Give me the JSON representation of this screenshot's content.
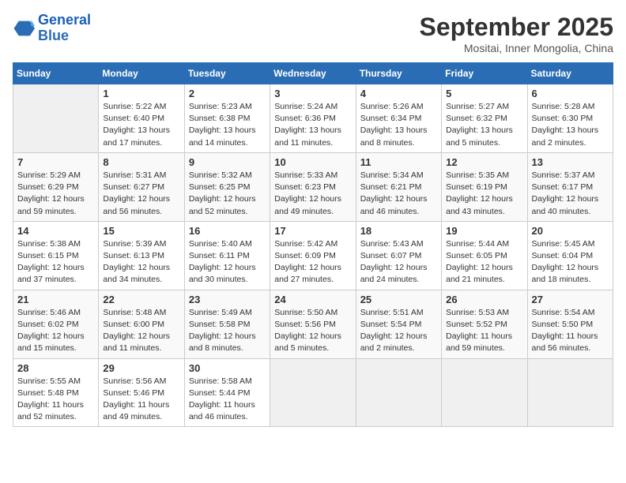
{
  "logo": {
    "line1": "General",
    "line2": "Blue"
  },
  "title": "September 2025",
  "location": "Mositai, Inner Mongolia, China",
  "weekdays": [
    "Sunday",
    "Monday",
    "Tuesday",
    "Wednesday",
    "Thursday",
    "Friday",
    "Saturday"
  ],
  "weeks": [
    [
      {
        "num": "",
        "sunrise": "",
        "sunset": "",
        "daylight": "",
        "empty": true
      },
      {
        "num": "1",
        "sunrise": "Sunrise: 5:22 AM",
        "sunset": "Sunset: 6:40 PM",
        "daylight": "Daylight: 13 hours and 17 minutes."
      },
      {
        "num": "2",
        "sunrise": "Sunrise: 5:23 AM",
        "sunset": "Sunset: 6:38 PM",
        "daylight": "Daylight: 13 hours and 14 minutes."
      },
      {
        "num": "3",
        "sunrise": "Sunrise: 5:24 AM",
        "sunset": "Sunset: 6:36 PM",
        "daylight": "Daylight: 13 hours and 11 minutes."
      },
      {
        "num": "4",
        "sunrise": "Sunrise: 5:26 AM",
        "sunset": "Sunset: 6:34 PM",
        "daylight": "Daylight: 13 hours and 8 minutes."
      },
      {
        "num": "5",
        "sunrise": "Sunrise: 5:27 AM",
        "sunset": "Sunset: 6:32 PM",
        "daylight": "Daylight: 13 hours and 5 minutes."
      },
      {
        "num": "6",
        "sunrise": "Sunrise: 5:28 AM",
        "sunset": "Sunset: 6:30 PM",
        "daylight": "Daylight: 13 hours and 2 minutes."
      }
    ],
    [
      {
        "num": "7",
        "sunrise": "Sunrise: 5:29 AM",
        "sunset": "Sunset: 6:29 PM",
        "daylight": "Daylight: 12 hours and 59 minutes."
      },
      {
        "num": "8",
        "sunrise": "Sunrise: 5:31 AM",
        "sunset": "Sunset: 6:27 PM",
        "daylight": "Daylight: 12 hours and 56 minutes."
      },
      {
        "num": "9",
        "sunrise": "Sunrise: 5:32 AM",
        "sunset": "Sunset: 6:25 PM",
        "daylight": "Daylight: 12 hours and 52 minutes."
      },
      {
        "num": "10",
        "sunrise": "Sunrise: 5:33 AM",
        "sunset": "Sunset: 6:23 PM",
        "daylight": "Daylight: 12 hours and 49 minutes."
      },
      {
        "num": "11",
        "sunrise": "Sunrise: 5:34 AM",
        "sunset": "Sunset: 6:21 PM",
        "daylight": "Daylight: 12 hours and 46 minutes."
      },
      {
        "num": "12",
        "sunrise": "Sunrise: 5:35 AM",
        "sunset": "Sunset: 6:19 PM",
        "daylight": "Daylight: 12 hours and 43 minutes."
      },
      {
        "num": "13",
        "sunrise": "Sunrise: 5:37 AM",
        "sunset": "Sunset: 6:17 PM",
        "daylight": "Daylight: 12 hours and 40 minutes."
      }
    ],
    [
      {
        "num": "14",
        "sunrise": "Sunrise: 5:38 AM",
        "sunset": "Sunset: 6:15 PM",
        "daylight": "Daylight: 12 hours and 37 minutes."
      },
      {
        "num": "15",
        "sunrise": "Sunrise: 5:39 AM",
        "sunset": "Sunset: 6:13 PM",
        "daylight": "Daylight: 12 hours and 34 minutes."
      },
      {
        "num": "16",
        "sunrise": "Sunrise: 5:40 AM",
        "sunset": "Sunset: 6:11 PM",
        "daylight": "Daylight: 12 hours and 30 minutes."
      },
      {
        "num": "17",
        "sunrise": "Sunrise: 5:42 AM",
        "sunset": "Sunset: 6:09 PM",
        "daylight": "Daylight: 12 hours and 27 minutes."
      },
      {
        "num": "18",
        "sunrise": "Sunrise: 5:43 AM",
        "sunset": "Sunset: 6:07 PM",
        "daylight": "Daylight: 12 hours and 24 minutes."
      },
      {
        "num": "19",
        "sunrise": "Sunrise: 5:44 AM",
        "sunset": "Sunset: 6:05 PM",
        "daylight": "Daylight: 12 hours and 21 minutes."
      },
      {
        "num": "20",
        "sunrise": "Sunrise: 5:45 AM",
        "sunset": "Sunset: 6:04 PM",
        "daylight": "Daylight: 12 hours and 18 minutes."
      }
    ],
    [
      {
        "num": "21",
        "sunrise": "Sunrise: 5:46 AM",
        "sunset": "Sunset: 6:02 PM",
        "daylight": "Daylight: 12 hours and 15 minutes."
      },
      {
        "num": "22",
        "sunrise": "Sunrise: 5:48 AM",
        "sunset": "Sunset: 6:00 PM",
        "daylight": "Daylight: 12 hours and 11 minutes."
      },
      {
        "num": "23",
        "sunrise": "Sunrise: 5:49 AM",
        "sunset": "Sunset: 5:58 PM",
        "daylight": "Daylight: 12 hours and 8 minutes."
      },
      {
        "num": "24",
        "sunrise": "Sunrise: 5:50 AM",
        "sunset": "Sunset: 5:56 PM",
        "daylight": "Daylight: 12 hours and 5 minutes."
      },
      {
        "num": "25",
        "sunrise": "Sunrise: 5:51 AM",
        "sunset": "Sunset: 5:54 PM",
        "daylight": "Daylight: 12 hours and 2 minutes."
      },
      {
        "num": "26",
        "sunrise": "Sunrise: 5:53 AM",
        "sunset": "Sunset: 5:52 PM",
        "daylight": "Daylight: 11 hours and 59 minutes."
      },
      {
        "num": "27",
        "sunrise": "Sunrise: 5:54 AM",
        "sunset": "Sunset: 5:50 PM",
        "daylight": "Daylight: 11 hours and 56 minutes."
      }
    ],
    [
      {
        "num": "28",
        "sunrise": "Sunrise: 5:55 AM",
        "sunset": "Sunset: 5:48 PM",
        "daylight": "Daylight: 11 hours and 52 minutes."
      },
      {
        "num": "29",
        "sunrise": "Sunrise: 5:56 AM",
        "sunset": "Sunset: 5:46 PM",
        "daylight": "Daylight: 11 hours and 49 minutes."
      },
      {
        "num": "30",
        "sunrise": "Sunrise: 5:58 AM",
        "sunset": "Sunset: 5:44 PM",
        "daylight": "Daylight: 11 hours and 46 minutes."
      },
      {
        "num": "",
        "sunrise": "",
        "sunset": "",
        "daylight": "",
        "empty": true
      },
      {
        "num": "",
        "sunrise": "",
        "sunset": "",
        "daylight": "",
        "empty": true
      },
      {
        "num": "",
        "sunrise": "",
        "sunset": "",
        "daylight": "",
        "empty": true
      },
      {
        "num": "",
        "sunrise": "",
        "sunset": "",
        "daylight": "",
        "empty": true
      }
    ]
  ]
}
